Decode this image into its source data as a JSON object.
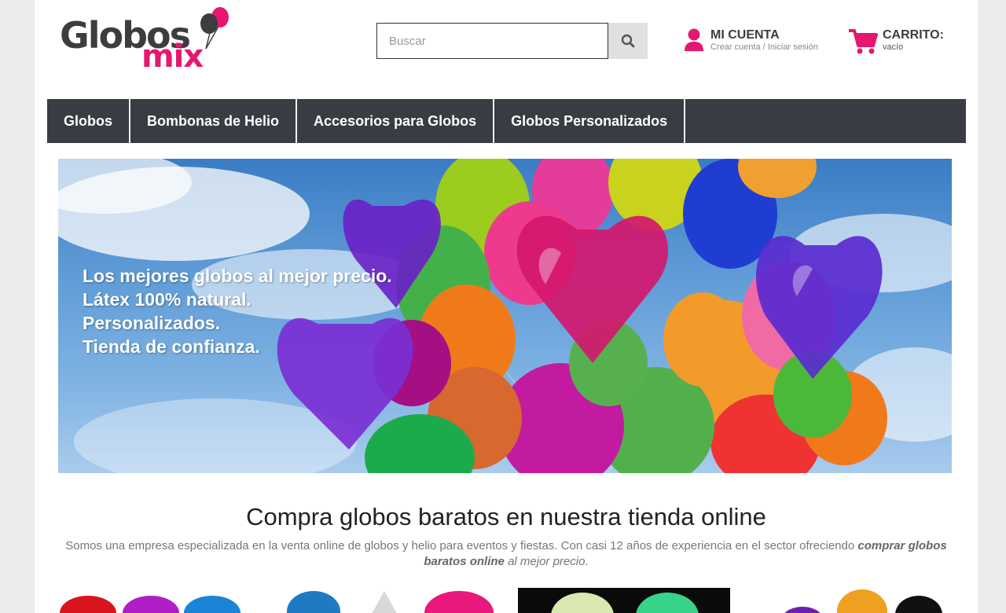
{
  "header": {
    "logo": {
      "word": "Globos",
      "sub": "mix"
    },
    "search": {
      "placeholder": "Buscar"
    },
    "account": {
      "title": "MI CUENTA",
      "subtitle": "Crear cuenta / Iniciar sesión"
    },
    "cart": {
      "title": "CARRITO:",
      "subtitle": "vacío"
    }
  },
  "nav": {
    "items": [
      {
        "label": "Globos"
      },
      {
        "label": "Bombonas de Helio"
      },
      {
        "label": "Accesorios para Globos"
      },
      {
        "label": "Globos Personalizados"
      }
    ]
  },
  "hero": {
    "lines": [
      "Los mejores globos al mejor precio.",
      "Látex 100% natural.",
      "Personalizados.",
      "Tienda de confianza."
    ]
  },
  "main": {
    "title": "Compra globos baratos en nuestra tienda online",
    "intro": {
      "text": "Somos una empresa especializada en la venta online de globos y helio para eventos y fiestas. Con casi 12 años de experiencia en el sector ofreciendo ",
      "bold": "comprar globos baratos online",
      "tail": " al mejor precio."
    }
  },
  "icons": {
    "search": "search-icon",
    "account": "user-icon",
    "cart": "cart-icon"
  },
  "colors": {
    "brand": "#e5176f",
    "nav": "#393c42",
    "text_dark": "#3d3d40"
  }
}
